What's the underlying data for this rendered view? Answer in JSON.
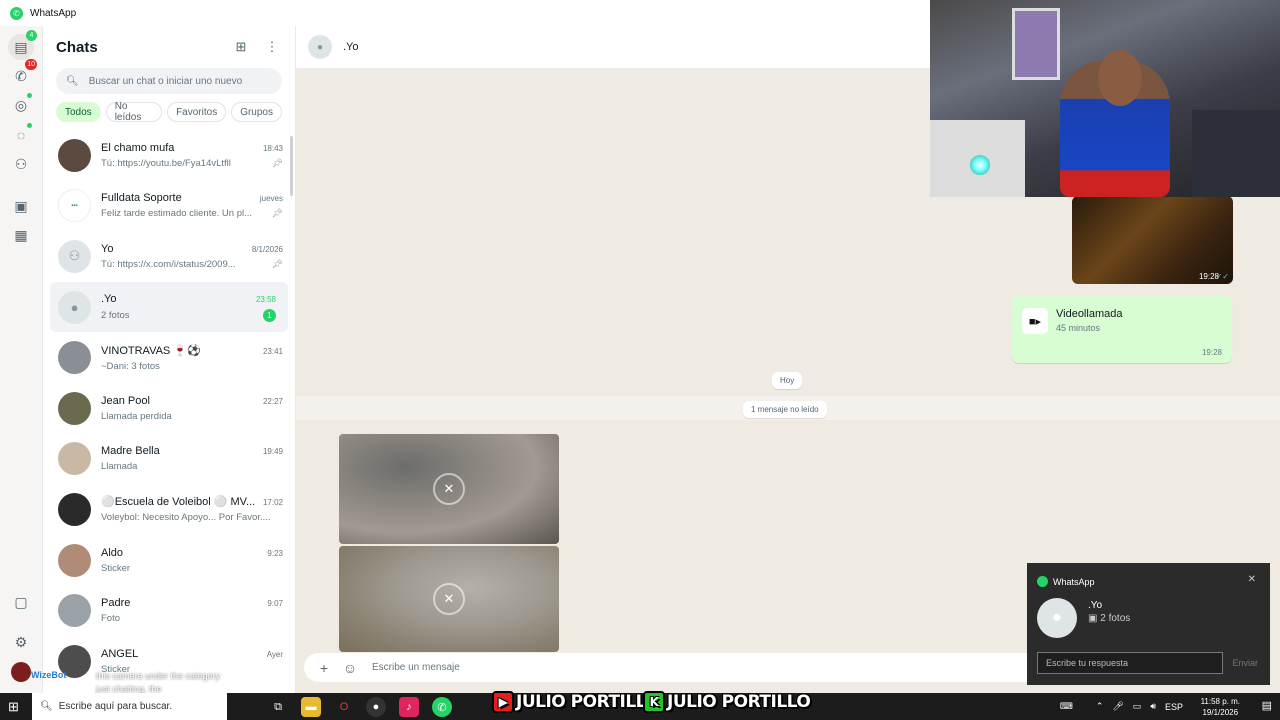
{
  "window": {
    "title": "WhatsApp"
  },
  "rail": {
    "chats_badge": "4",
    "calls_badge": "10"
  },
  "list": {
    "title": "Chats",
    "search_placeholder": "Buscar un chat o iniciar uno nuevo",
    "filters": [
      "Todos",
      "No leídos",
      "Favoritos",
      "Grupos"
    ],
    "chats": [
      {
        "name": "El chamo mufa",
        "time": "18:43",
        "preview": "Tú: https://youtu.be/Fya14vLtfll",
        "pinned": true,
        "avatar_color": "#5b4a3f"
      },
      {
        "name": "Fulldata Soporte",
        "time": "jueves",
        "preview": "Feliz tarde estimado cliente. Un pl...",
        "pinned": true,
        "avatar_color": "#ffffff"
      },
      {
        "name": "Yo",
        "time": "8/1/2026",
        "preview": "Tú: https://x.com/i/status/2009...",
        "pinned": true,
        "avatar_color": "#dfe5e7"
      },
      {
        "name": ".Yo",
        "time": "23:58",
        "preview": "2 fotos",
        "unread": "1",
        "avatar_color": "#dfe5e7"
      },
      {
        "name": "VINOTRAVAS 🍷⚽",
        "time": "23:41",
        "preview": "~Dani: 3 fotos",
        "avatar_color": "#8a8f96"
      },
      {
        "name": "Jean Pool",
        "time": "22:27",
        "preview": "Llamada perdida",
        "avatar_color": "#6b6a4e"
      },
      {
        "name": "Madre Bella",
        "time": "19:49",
        "preview": "Llamada",
        "avatar_color": "#c9b8a6"
      },
      {
        "name": "⚪Escuela de Voleibol ⚪ MV...",
        "time": "17:02",
        "preview": "Voleybol: Necesito Apoyo... Por Favor....",
        "avatar_color": "#2a2a2a"
      },
      {
        "name": "Aldo",
        "time": "9:23",
        "preview": "Sticker",
        "avatar_color": "#b08c78"
      },
      {
        "name": "Padre",
        "time": "9:07",
        "preview": "Foto",
        "avatar_color": "#9aa2a8"
      },
      {
        "name": "ANGEL",
        "time": "Ayer",
        "preview": "Sticker",
        "avatar_color": "#4d4d4d"
      }
    ]
  },
  "conversation": {
    "title": ".Yo",
    "photo_time": "19:28",
    "videocall": {
      "title": "Videollamada",
      "subtitle": "45 minutos",
      "time": "19:28"
    },
    "date_pill": "Hoy",
    "unread_pill": "1 mensaje no leído",
    "composer_placeholder": "Escribe un mensaje"
  },
  "toast": {
    "app": "WhatsApp",
    "sender": ".Yo",
    "message": "2 fotos",
    "reply_placeholder": "Escribe tu respuesta",
    "send": "Enviar"
  },
  "overlay": {
    "bot_name": "WizeBot",
    "caption": "this camera under the category just chatting, the"
  },
  "taskbar": {
    "search": "Escribe aquí para buscar.",
    "banner_left": "JULIO PORTILLO",
    "banner_right": "JULIO PORTILLO",
    "language": "ESP",
    "time": "11:58 p. m.",
    "date": "19/1/2026"
  }
}
